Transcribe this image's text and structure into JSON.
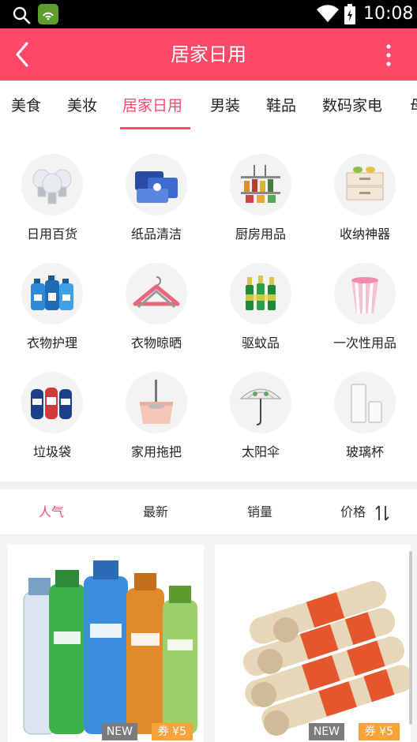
{
  "status_bar": {
    "time": "10:08"
  },
  "app_bar": {
    "title": "居家日用"
  },
  "tabs": [
    {
      "label": "美食"
    },
    {
      "label": "美妆"
    },
    {
      "label": "居家日用",
      "active": true
    },
    {
      "label": "男装"
    },
    {
      "label": "鞋品"
    },
    {
      "label": "数码家电"
    },
    {
      "label": "母"
    }
  ],
  "categories": [
    {
      "label": "日用百货",
      "icon": "lightbulb-icon"
    },
    {
      "label": "纸品清洁",
      "icon": "tissue-box-icon"
    },
    {
      "label": "厨房用品",
      "icon": "spice-rack-icon"
    },
    {
      "label": "收纳神器",
      "icon": "storage-drawer-icon"
    },
    {
      "label": "衣物护理",
      "icon": "detergent-icon"
    },
    {
      "label": "衣物晾晒",
      "icon": "hanger-icon"
    },
    {
      "label": "驱蚊品",
      "icon": "repellent-bottles-icon"
    },
    {
      "label": "一次性用品",
      "icon": "paper-cup-icon"
    },
    {
      "label": "垃圾袋",
      "icon": "trash-bag-icon"
    },
    {
      "label": "家用拖把",
      "icon": "mop-bucket-icon"
    },
    {
      "label": "太阳伞",
      "icon": "umbrella-icon"
    },
    {
      "label": "玻璃杯",
      "icon": "glass-icon"
    }
  ],
  "sort_bar": {
    "popular": "人气",
    "newest": "最新",
    "sales": "销量",
    "price": "价格"
  },
  "products": [
    {
      "badge_new": "NEW",
      "coupon": "券 ¥5",
      "image": "sports-bottles"
    },
    {
      "badge_new": "NEW",
      "coupon": "券 ¥5",
      "image": "incense-rolls"
    }
  ],
  "colors": {
    "accent": "#fe4a68",
    "coupon": "#f7a23b",
    "new_badge": "#7b7b7b"
  }
}
